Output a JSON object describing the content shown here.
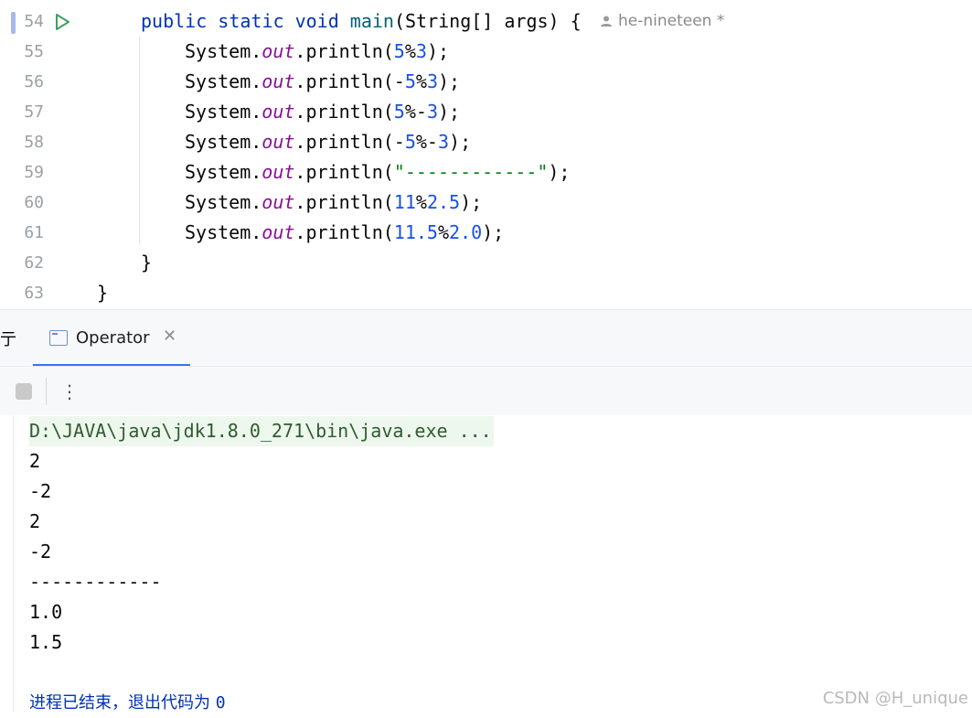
{
  "editor": {
    "author": "he-nineteen *",
    "lines": [
      {
        "num": "54",
        "code": "public static void main(String[] args) {"
      },
      {
        "num": "55",
        "code": "System.out.println(5%3);"
      },
      {
        "num": "56",
        "code": "System.out.println(-5%3);"
      },
      {
        "num": "57",
        "code": "System.out.println(5%-3);"
      },
      {
        "num": "58",
        "code": "System.out.println(-5%-3);"
      },
      {
        "num": "59",
        "code": "System.out.println(\"------------\");"
      },
      {
        "num": "60",
        "code": "System.out.println(11%2.5);"
      },
      {
        "num": "61",
        "code": "System.out.println(11.5%2.0);"
      },
      {
        "num": "62",
        "code": "}"
      },
      {
        "num": "63",
        "code": "}"
      }
    ]
  },
  "tabbar": {
    "prefix": "亍",
    "tab_label": "Operator"
  },
  "console": {
    "command": "D:\\JAVA\\java\\jdk1.8.0_271\\bin\\java.exe ...",
    "output": [
      "2",
      "-2",
      "2",
      "-2",
      "------------",
      "1.0",
      "1.5"
    ],
    "exit_text": "进程已结束，退出代码为",
    "exit_code": "0"
  },
  "watermark": "CSDN @H_unique",
  "colors": {
    "keyword": "#0033b3",
    "number": "#1750eb",
    "string": "#067d17",
    "static_field": "#871094",
    "accent": "#3574f0"
  }
}
